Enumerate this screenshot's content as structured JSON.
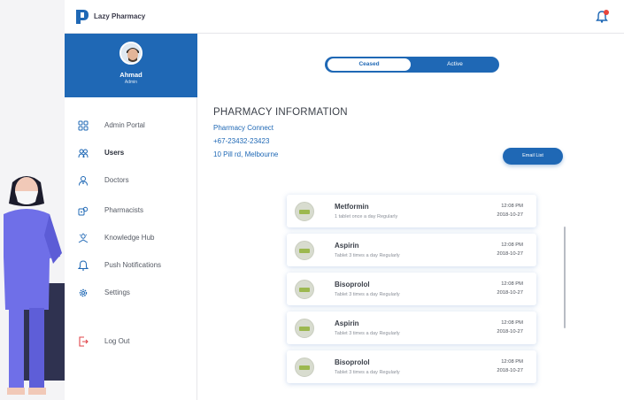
{
  "app": {
    "name": "Lazy Pharmacy"
  },
  "profile": {
    "name": "Ahmad",
    "role": "Admin"
  },
  "nav": [
    {
      "label": "Admin Portal",
      "icon": "grid-icon"
    },
    {
      "label": "Users",
      "icon": "users-icon"
    },
    {
      "label": "Doctors",
      "icon": "doctor-icon"
    },
    {
      "label": "Pharmacists",
      "icon": "pharmacist-icon"
    },
    {
      "label": "Knowledge Hub",
      "icon": "knowledge-icon"
    },
    {
      "label": "Push Notifications",
      "icon": "notification-icon"
    },
    {
      "label": "Settings",
      "icon": "gear-icon"
    },
    {
      "label": "Log Out",
      "icon": "logout-icon"
    }
  ],
  "toggle": {
    "left": "Ceased",
    "right": "Active",
    "selected": "Ceased"
  },
  "pharmacy": {
    "title": "PHARMACY INFORMATION",
    "name": "Pharmacy Connect",
    "phone": "+67-23432-23423",
    "address": "10 Pill rd, Melbourne",
    "email_button": "Email List"
  },
  "medications": [
    {
      "name": "Metformin",
      "dose": "1 tablet once a day Regularly",
      "time": "12:08 PM",
      "date": "2018-10-27"
    },
    {
      "name": "Aspirin",
      "dose": "Tablet 3 times a day Regularly",
      "time": "12:08 PM",
      "date": "2018-10-27"
    },
    {
      "name": "Bisoprolol",
      "dose": "Tablet 3 times a day Regularly",
      "time": "12:08 PM",
      "date": "2018-10-27"
    },
    {
      "name": "Aspirin",
      "dose": "Tablet 3 times a day Regularly",
      "time": "12:08 PM",
      "date": "2018-10-27"
    },
    {
      "name": "Bisoprolol",
      "dose": "Tablet 3 times a day Regularly",
      "time": "12:08 PM",
      "date": "2018-10-27"
    }
  ],
  "colors": {
    "primary": "#1f68b5",
    "alert": "#e8453c",
    "logout": "#e0454a"
  }
}
